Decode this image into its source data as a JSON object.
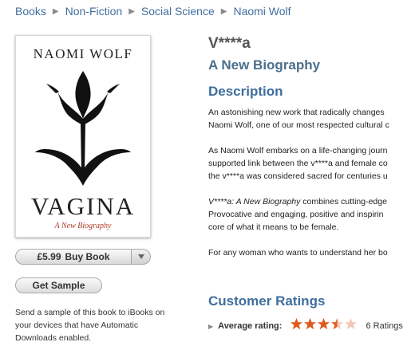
{
  "breadcrumb": [
    "Books",
    "Non-Fiction",
    "Social Science",
    "Naomi Wolf"
  ],
  "cover": {
    "author": "NAOMI WOLF",
    "title": "VAGINA",
    "subtitle": "A New Biography"
  },
  "buy": {
    "price": "£5.99",
    "label": "Buy Book"
  },
  "sample": {
    "label": "Get Sample",
    "note_lines": [
      "Send a sample of this book to iBooks on",
      "your devices that have Automatic",
      "Downloads enabled."
    ]
  },
  "book": {
    "title": "V****a",
    "subtitle": "A New Biography"
  },
  "description": {
    "heading": "Description",
    "p1": [
      "An astonishing new work that radically changes",
      "Naomi Wolf, one of our most respected cultural c"
    ],
    "p2": [
      "As Naomi Wolf embarks on a life-changing journ",
      "supported link between the v****a and female co",
      "the v****a was considered sacred for centuries u"
    ],
    "p3_italic": "V****a: A New Biography",
    "p3_rest": " combines cutting-edge",
    "p3": [
      "Provocative and engaging, positive and inspirin",
      "core of what it means to be female."
    ],
    "p4": "For any woman who wants to understand her bo"
  },
  "ratings": {
    "heading": "Customer Ratings",
    "label": "Average rating:",
    "stars": 3.5,
    "count_text": "6 Ratings",
    "star_color": "#e05a1e"
  }
}
